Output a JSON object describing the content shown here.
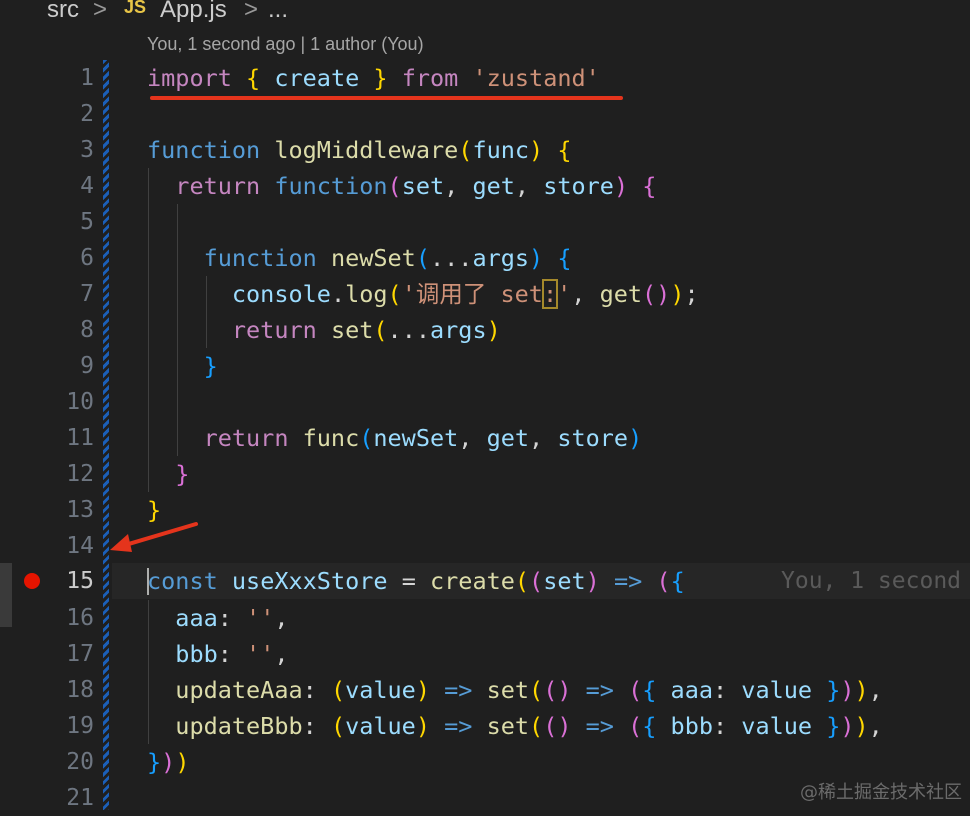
{
  "breadcrumb": {
    "folder": "src",
    "sep1": ">",
    "js_badge": "JS",
    "file": "App.js",
    "sep2": ">",
    "more": "..."
  },
  "blame_header": "You, 1 second ago | 1 author (You)",
  "inline_blame": "You, 1 second",
  "watermark": "@稀土掘金技术社区",
  "colors": {
    "background": "#1f1f1f",
    "keyword": "#c586c0",
    "storage": "#569cd6",
    "function": "#dcdcaa",
    "variable": "#9cdcfe",
    "string": "#ce9178",
    "breakpoint": "#e51400",
    "annotation": "#e4341c",
    "blame_strip": "#1b5fb8"
  },
  "gutter": [
    "1",
    "2",
    "3",
    "4",
    "5",
    "6",
    "7",
    "8",
    "9",
    "10",
    "11",
    "12",
    "13",
    "14",
    "15",
    "16",
    "17",
    "18",
    "19",
    "20",
    "21"
  ],
  "code": {
    "l1": {
      "import": "import",
      "ob": "{",
      "create": "create",
      "cb": "}",
      "from": "from",
      "mod": "'zustand'"
    },
    "l3": {
      "function": "function",
      "name": "logMiddleware",
      "op": "(",
      "param": "func",
      "cp": ")",
      "ob": "{"
    },
    "l4": {
      "return": "return",
      "function": "function",
      "op": "(",
      "set": "set",
      "c1": ", ",
      "get": "get",
      "c2": ", ",
      "store": "store",
      "cp": ")",
      "ob": "{"
    },
    "l6": {
      "function": "function",
      "name": "newSet",
      "op": "(",
      "spread": "...",
      "args": "args",
      "cp": ")",
      "ob": "{"
    },
    "l7": {
      "console": "console",
      "dot": ".",
      "log": "log",
      "op": "(",
      "str_a": "'调用了 set",
      "str_sel": ":",
      "str_b": "'",
      "comma": ", ",
      "get": "get",
      "gp": "()",
      "cp": ")",
      "semi": ";"
    },
    "l8": {
      "return": "return",
      "set": "set",
      "op": "(",
      "spread": "...",
      "args": "args",
      "cp": ")"
    },
    "l9": {
      "cb": "}"
    },
    "l11": {
      "return": "return",
      "func": "func",
      "op": "(",
      "newSet": "newSet",
      "c1": ", ",
      "get": "get",
      "c2": ", ",
      "store": "store",
      "cp": ")"
    },
    "l12": {
      "cb": "}"
    },
    "l13": {
      "cb": "}"
    },
    "l15": {
      "const": "const",
      "name": "useXxxStore",
      "eq": " = ",
      "create": "create",
      "op": "(",
      "op2": "(",
      "set": "set",
      "cp2": ")",
      "arrow": " => ",
      "op3": "(",
      "ob": "{"
    },
    "l16": {
      "key": "aaa",
      "colon": ": ",
      "val": "''",
      "comma": ","
    },
    "l17": {
      "key": "bbb",
      "colon": ": ",
      "val": "''",
      "comma": ","
    },
    "l18": {
      "key": "updateAaa",
      "colon": ": ",
      "op": "(",
      "value": "value",
      "cp": ")",
      "arrow": " => ",
      "set": "set",
      "op2": "(",
      "pp": "()",
      "arrow2": " => ",
      "op3": "(",
      "ob": "{ ",
      "k": "aaa",
      "colon2": ": ",
      "v": "value",
      "cb": " }",
      "cp3": ")",
      "cp2": ")",
      "comma": ","
    },
    "l19": {
      "key": "updateBbb",
      "colon": ": ",
      "op": "(",
      "value": "value",
      "cp": ")",
      "arrow": " => ",
      "set": "set",
      "op2": "(",
      "pp": "()",
      "arrow2": " => ",
      "op3": "(",
      "ob": "{ ",
      "k": "bbb",
      "colon2": ": ",
      "v": "value",
      "cb": " }",
      "cp3": ")",
      "cp2": ")",
      "comma": ","
    },
    "l20": {
      "cb": "}",
      "cp1": ")",
      "cp2": ")"
    }
  }
}
